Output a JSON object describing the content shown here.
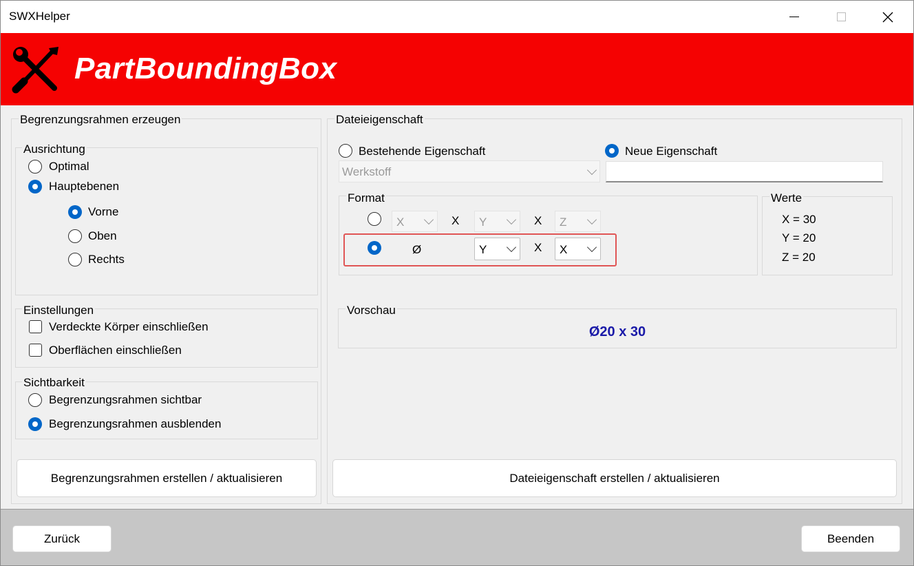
{
  "window": {
    "title": "SWXHelper",
    "controls": {
      "minimize": "minimize-icon",
      "maximize": "maximize-icon",
      "close": "close-icon"
    }
  },
  "banner": {
    "title": "PartBoundingBox",
    "icon": "wrench-screwdriver-icon",
    "color": "#f50202"
  },
  "left": {
    "title": "Begrenzungsrahmen erzeugen",
    "ausrichtung": {
      "title": "Ausrichtung",
      "optimal": "Optimal",
      "hauptebenen": "Hauptebenen",
      "vorne": "Vorne",
      "oben": "Oben",
      "rechts": "Rechts"
    },
    "einstellungen": {
      "title": "Einstellungen",
      "verdeckte": "Verdeckte Körper einschließen",
      "oberflaechen": "Oberflächen einschließen"
    },
    "sichtbarkeit": {
      "title": "Sichtbarkeit",
      "sichtbar": "Begrenzungsrahmen sichtbar",
      "ausblenden": "Begrenzungsrahmen ausblenden"
    },
    "create_button": "Begrenzungsrahmen erstellen / aktualisieren"
  },
  "right": {
    "title": "Dateieigenschaft",
    "bestehende": "Bestehende Eigenschaft",
    "neue": "Neue Eigenschaft",
    "property_combo": "Werkstoff",
    "new_property_value": "",
    "format": {
      "title": "Format",
      "row1": {
        "combo1": "X",
        "sep1": "X",
        "combo2": "Y",
        "sep2": "X",
        "combo3": "Z"
      },
      "row2": {
        "diameter": "Ø",
        "combo1": "Y",
        "sep1": "X",
        "combo2": "X"
      }
    },
    "werte": {
      "title": "Werte",
      "x": "X = 30",
      "y": "Y = 20",
      "z": "Z = 20"
    },
    "vorschau": {
      "title": "Vorschau",
      "value": "Ø20 x 30",
      "color": "#1a1aa8"
    },
    "create_button": "Dateieigenschaft erstellen / aktualisieren"
  },
  "footer": {
    "back": "Zurück",
    "exit": "Beenden"
  },
  "selection": {
    "ausrichtung": "Hauptebenen",
    "ebene": "Vorne",
    "sichtbarkeit": "Begrenzungsrahmen ausblenden",
    "eigenschaft": "Neue Eigenschaft",
    "format": "row2"
  }
}
